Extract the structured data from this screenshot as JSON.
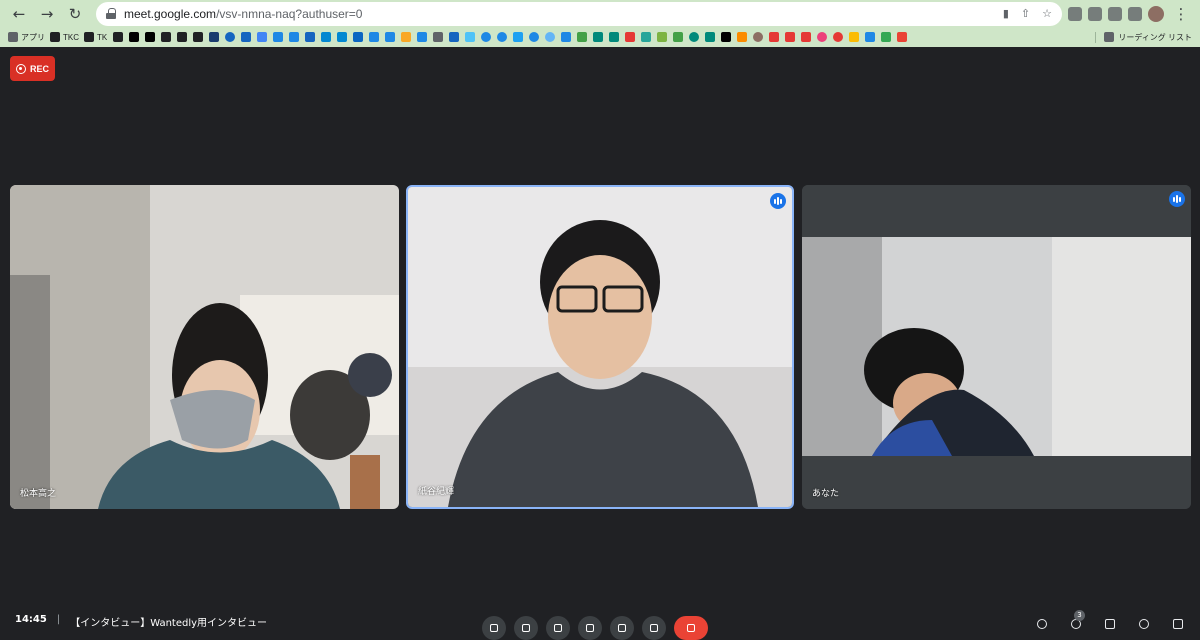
{
  "browser": {
    "url_host": "meet.google.com",
    "url_path": "/vsv-nmna-naq?authuser=0",
    "bookmarks": [
      {
        "label": "アプリ",
        "icon": "apps-grid-icon",
        "color": "#5f6368"
      },
      {
        "label": "TKC",
        "icon": "tkc-icon",
        "color": "#202124"
      },
      {
        "label": "TK",
        "icon": "tk-icon",
        "color": "#202124"
      },
      {
        "label": "",
        "icon": "hr-icon",
        "color": "#202124"
      },
      {
        "label": "",
        "icon": "b-icon",
        "color": "#000000"
      },
      {
        "label": "",
        "icon": "arrow-icon",
        "color": "#000000"
      },
      {
        "label": "",
        "icon": "c-icon",
        "color": "#202124"
      },
      {
        "label": "",
        "icon": "c-icon",
        "color": "#202124"
      },
      {
        "label": "",
        "icon": "n-icon",
        "color": "#202124"
      },
      {
        "label": "",
        "icon": "dot-icon",
        "color": "#1a3c6e"
      },
      {
        "label": "",
        "icon": "globe-icon",
        "color": "#1565c0"
      },
      {
        "label": "",
        "icon": "w-icon",
        "color": "#1565c0"
      },
      {
        "label": "",
        "icon": "doc-icon",
        "color": "#4285f4"
      },
      {
        "label": "",
        "icon": "doc-icon",
        "color": "#1e88e5"
      },
      {
        "label": "",
        "icon": "box-icon",
        "color": "#1e88e5"
      },
      {
        "label": "",
        "icon": "chat-icon",
        "color": "#1565c0"
      },
      {
        "label": "",
        "icon": "t-icon",
        "color": "#0288d1"
      },
      {
        "label": "",
        "icon": "t-icon",
        "color": "#0288d1"
      },
      {
        "label": "",
        "icon": "linkedin-icon",
        "color": "#0a66c2"
      },
      {
        "label": "",
        "icon": "cal-icon",
        "color": "#1e88e5"
      },
      {
        "label": "",
        "icon": "drive-icon",
        "color": "#1e88e5"
      },
      {
        "label": "",
        "icon": "pen-icon",
        "color": "#f9a825"
      },
      {
        "label": "",
        "icon": "doc-icon",
        "color": "#1e88e5"
      },
      {
        "label": "",
        "icon": "grid-icon",
        "color": "#5f6368"
      },
      {
        "label": "",
        "icon": "w-icon",
        "color": "#1565c0"
      },
      {
        "label": "",
        "icon": "drop-icon",
        "color": "#4fc3f7"
      },
      {
        "label": "",
        "icon": "circle-icon",
        "color": "#1e88e5"
      },
      {
        "label": "",
        "icon": "circle-icon",
        "color": "#1e88e5"
      },
      {
        "label": "",
        "icon": "twitter-icon",
        "color": "#1da1f2"
      },
      {
        "label": "",
        "icon": "circle-icon",
        "color": "#1e88e5"
      },
      {
        "label": "",
        "icon": "circle-icon",
        "color": "#64b5f6"
      },
      {
        "label": "",
        "icon": "jo-icon",
        "color": "#1e88e5"
      },
      {
        "label": "",
        "icon": "g-icon",
        "color": "#43a047"
      },
      {
        "label": "",
        "icon": "plus-icon",
        "color": "#00897b"
      },
      {
        "label": "",
        "icon": "t-icon",
        "color": "#00897b"
      },
      {
        "label": "",
        "icon": "cal-icon",
        "color": "#e53935"
      },
      {
        "label": "",
        "icon": "square-icon",
        "color": "#26a69a"
      },
      {
        "label": "",
        "icon": "square-icon",
        "color": "#7cb342"
      },
      {
        "label": "",
        "icon": "square-icon",
        "color": "#43a047"
      },
      {
        "label": "",
        "icon": "circle-icon",
        "color": "#00897b"
      },
      {
        "label": "",
        "icon": "tag-icon",
        "color": "#00897b"
      },
      {
        "label": "",
        "icon": "bolt-icon",
        "color": "#000000"
      },
      {
        "label": "",
        "icon": "star-icon",
        "color": "#fb8c00"
      },
      {
        "label": "",
        "icon": "circle-icon",
        "color": "#8d6e63"
      },
      {
        "label": "",
        "icon": "youtube-icon",
        "color": "#e53935"
      },
      {
        "label": "",
        "icon": "check-icon",
        "color": "#e53935"
      },
      {
        "label": "",
        "icon": "a-icon",
        "color": "#e53935"
      },
      {
        "label": "",
        "icon": "circle-icon",
        "color": "#ec407a"
      },
      {
        "label": "",
        "icon": "circle-icon",
        "color": "#e53935"
      },
      {
        "label": "",
        "icon": "drive-icon",
        "color": "#fbbc04"
      },
      {
        "label": "",
        "icon": "square-icon",
        "color": "#1e88e5"
      },
      {
        "label": "",
        "icon": "maps-icon",
        "color": "#34a853"
      },
      {
        "label": "",
        "icon": "gmail-icon",
        "color": "#ea4335"
      }
    ],
    "reading_list": "リーディング リスト"
  },
  "rec_label": "REC",
  "participants": [
    {
      "name": "松本高之",
      "speaking": false
    },
    {
      "name": "紙谷紀輝",
      "speaking": true
    },
    {
      "name": "あなた",
      "speaking": true
    }
  ],
  "bottom": {
    "clock": "14:45",
    "separator": "|",
    "meeting_title": "【インタビュー】Wantedly用インタビュー",
    "participant_count": "3"
  }
}
